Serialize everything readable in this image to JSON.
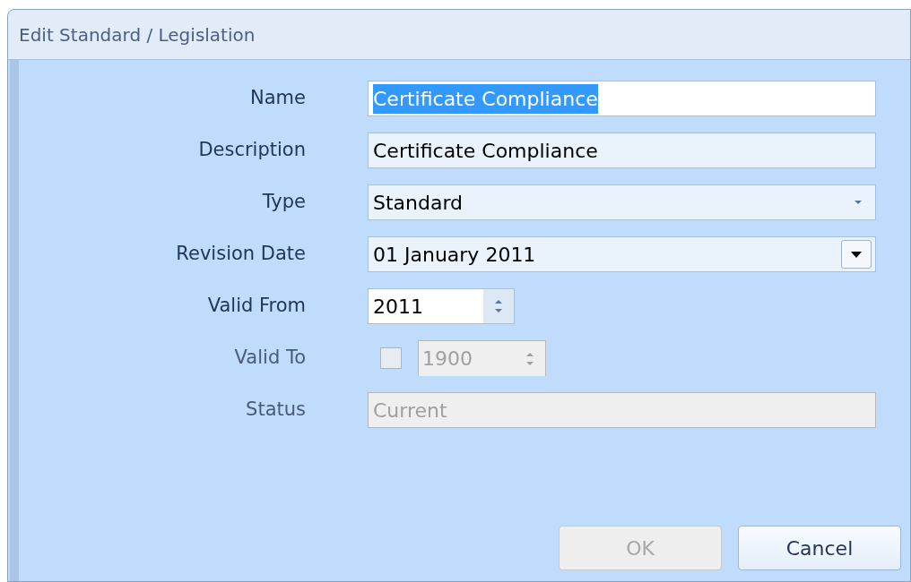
{
  "window": {
    "title": "Edit Standard / Legislation"
  },
  "fields": [
    {
      "label": "Name",
      "kind": "text",
      "value": "Certificate Compliance",
      "highlighted": true,
      "disabled": false
    },
    {
      "label": "Description",
      "kind": "text",
      "value": "Certificate Compliance",
      "highlighted": false,
      "disabled": false
    },
    {
      "label": "Type",
      "kind": "combo",
      "value": "Standard",
      "disabled": false
    },
    {
      "label": "Revision Date",
      "kind": "date",
      "value": "01 January 2011",
      "disabled": false
    },
    {
      "label": "Valid From",
      "kind": "spin",
      "value": "2011",
      "disabled": false
    },
    {
      "label": "Valid To",
      "kind": "checkspin",
      "value": "1900",
      "checked": false,
      "disabled": true
    },
    {
      "label": "Status",
      "kind": "text",
      "value": "Current",
      "highlighted": false,
      "disabled": true
    }
  ],
  "buttons": [
    {
      "label": "OK",
      "disabled": true
    },
    {
      "label": "Cancel",
      "disabled": false
    }
  ]
}
